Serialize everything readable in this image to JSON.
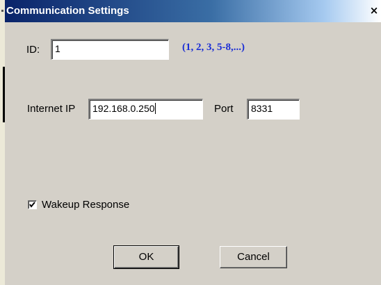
{
  "window": {
    "title": "Communication Settings",
    "close_glyph": "×"
  },
  "form": {
    "id_label": "ID:",
    "id_value": "1",
    "id_hint": "(1, 2, 3, 5-8,...)",
    "ip_label": "Internet IP",
    "ip_value": "192.168.0.250",
    "port_label": "Port",
    "port_value": "8331",
    "wakeup_label": "Wakeup Response",
    "wakeup_checked": true
  },
  "buttons": {
    "ok_label": "OK",
    "cancel_label": "Cancel"
  },
  "colors": {
    "title_bar_start": "#0a246a",
    "dialog_face": "#d4d0c8",
    "hint_text": "#1c2fd6"
  },
  "icons": {
    "close": "close-icon",
    "check": "check-icon"
  }
}
